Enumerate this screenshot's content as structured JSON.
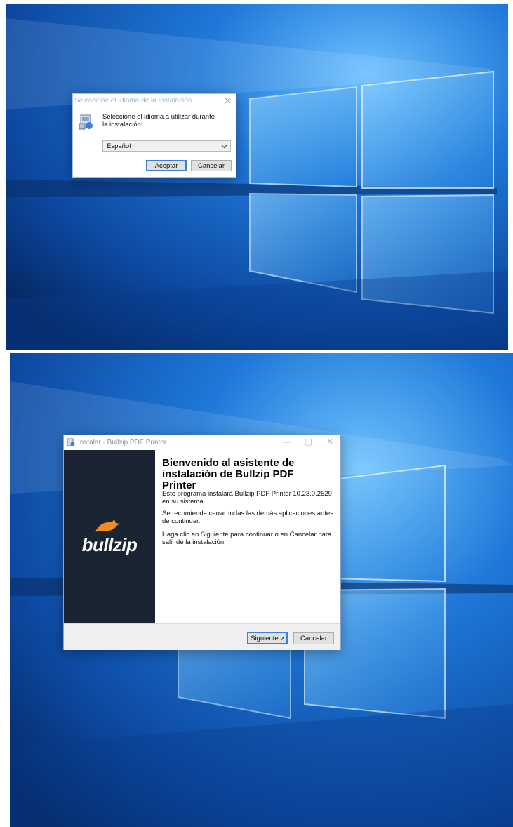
{
  "language_dialog": {
    "title": "Seleccione el Idioma de la Instalación",
    "message": "Seleccione el idioma a utilizar durante la instalación:",
    "selected_language": "Español",
    "accept_label": "Aceptar",
    "cancel_label": "Cancelar",
    "close_glyph": "✕"
  },
  "installer": {
    "title": "Instalar - Bullzip PDF Printer",
    "heading": "Bienvenido al asistente de instalación de Bullzip PDF Printer",
    "paragraphs": [
      "Este programa instalará Bullzip PDF Printer 10.23.0.2529 en su sistema.",
      "Se recomienda cerrar todas las demás aplicaciones antes de continuar.",
      "Haga clic en Siguiente para continuar o en Cancelar para salir de la instalación."
    ],
    "brand": "bullzip",
    "next_label": "Siguiente >",
    "cancel_label": "Cancelar",
    "minimize_glyph": "—",
    "maximize_glyph": "▢",
    "close_glyph": "✕"
  },
  "colors": {
    "desktop_dark": "#0b2f6e",
    "desktop_mid": "#1f6fcf",
    "desktop_light": "#5fb3f5",
    "sidebar": "#1a2433",
    "bull_orange": "#f28c1e",
    "accent_blue": "#3c7fd6"
  },
  "icons": [
    "installer-icon",
    "chevron-down-icon",
    "close-icon",
    "minimize-icon",
    "maximize-icon",
    "bull-logo-icon"
  ]
}
